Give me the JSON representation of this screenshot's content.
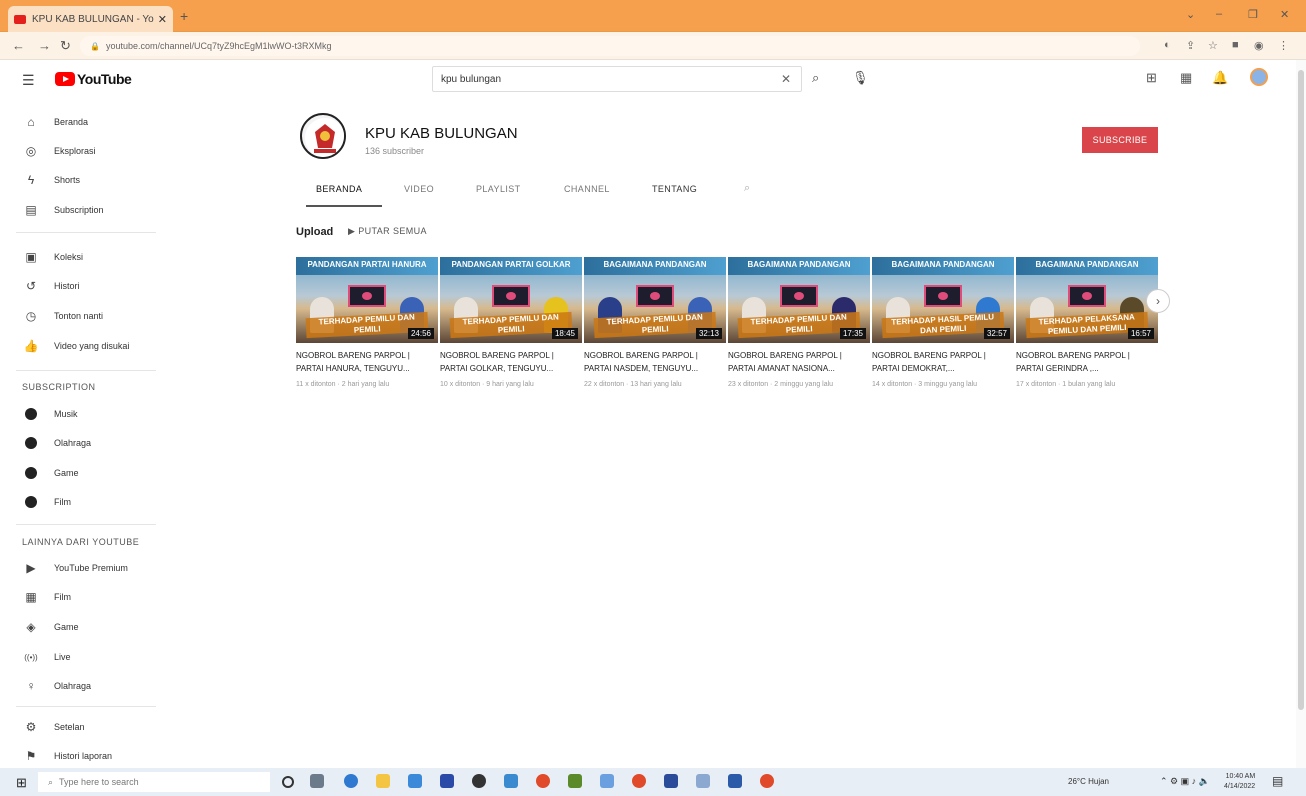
{
  "browser": {
    "tab_title": "KPU KAB BULUNGAN - YouTube",
    "tab_close": "✕",
    "new_tab": "+",
    "url": "youtube.com/channel/UCq7tyZ9hcEgM1lwWO-t3RXMkg",
    "window_controls": [
      "⌄",
      "–",
      "❐",
      "✕"
    ]
  },
  "youtube": {
    "logo_text": "YouTube",
    "search_value": "kpu bulungan",
    "search_clear": "✕"
  },
  "sidebar": {
    "main": [
      {
        "icon": "⌂",
        "label": "Beranda"
      },
      {
        "icon": "◎",
        "label": "Eksplorasi"
      },
      {
        "icon": "ϟ",
        "label": "Shorts"
      },
      {
        "icon": "▤",
        "label": "Subscription"
      }
    ],
    "library": [
      {
        "icon": "▣",
        "label": "Koleksi"
      },
      {
        "icon": "↺",
        "label": "Histori"
      },
      {
        "icon": "◷",
        "label": "Tonton nanti"
      },
      {
        "icon": "👍",
        "label": "Video yang disukai"
      }
    ],
    "subscription_header": "SUBSCRIPTION",
    "subscriptions": [
      {
        "label": "Musik"
      },
      {
        "label": "Olahraga"
      },
      {
        "label": "Game"
      },
      {
        "label": "Film"
      }
    ],
    "more_header": "LAINNYA DARI YOUTUBE",
    "more": [
      {
        "icon": "▶",
        "label": "YouTube Premium"
      },
      {
        "icon": "▦",
        "label": "Film"
      },
      {
        "icon": "◈",
        "label": "Game"
      },
      {
        "icon": "((•))",
        "label": "Live"
      },
      {
        "icon": "♀",
        "label": "Olahraga"
      }
    ],
    "settings": [
      {
        "icon": "⚙",
        "label": "Setelan"
      },
      {
        "icon": "⚑",
        "label": "Histori laporan"
      }
    ]
  },
  "channel": {
    "name": "KPU KAB BULUNGAN",
    "subscribers": "136 subscriber",
    "subscribe_label": "SUBSCRIBE",
    "tabs": [
      "BERANDA",
      "VIDEO",
      "PLAYLIST",
      "CHANNEL",
      "TENTANG"
    ],
    "section_title": "Upload",
    "play_all": "▶  PUTAR SEMUA"
  },
  "videos": [
    {
      "thumb_title": "PANDANGAN PARTAI HANURA",
      "overlay": "TERHADAP PEMILU DAN PEMILI",
      "duration": "24:56",
      "title": "NGOBROL BARENG PARPOL | PARTAI HANURA, TENGUYU...",
      "meta": "11 x ditonton · 2 hari yang lalu"
    },
    {
      "thumb_title": "PANDANGAN PARTAI GOLKAR",
      "overlay": "TERHADAP PEMILU DAN PEMILI",
      "duration": "18:45",
      "title": "NGOBROL BARENG PARPOL | PARTAI GOLKAR, TENGUYU...",
      "meta": "10 x ditonton · 9 hari yang lalu"
    },
    {
      "thumb_title": "BAGAIMANA PANDANGAN",
      "overlay": "TERHADAP PEMILU DAN PEMILI",
      "duration": "32:13",
      "title": "NGOBROL BARENG PARPOL | PARTAI NASDEM, TENGUYU...",
      "meta": "22 x ditonton · 13 hari yang lalu"
    },
    {
      "thumb_title": "BAGAIMANA PANDANGAN",
      "overlay": "TERHADAP PEMILU DAN PEMILI",
      "duration": "17:35",
      "title": "NGOBROL BARENG PARPOL | PARTAI AMANAT NASIONA...",
      "meta": "23 x ditonton · 2 minggu yang lalu"
    },
    {
      "thumb_title": "BAGAIMANA PANDANGAN",
      "overlay": "TERHADAP HASIL PEMILU DAN PEMILI",
      "duration": "32:57",
      "title": "NGOBROL BARENG PARPOL | PARTAI DEMOKRAT,...",
      "meta": "14 x ditonton · 3 minggu yang lalu"
    },
    {
      "thumb_title": "BAGAIMANA PANDANGAN",
      "overlay": "TERHADAP PELAKSANA PEMILU DAN PEMILI",
      "duration": "16:57",
      "title": "NGOBROL BARENG PARPOL | PARTAI GERINDRA ,...",
      "meta": "17 x ditonton · 1 bulan yang lalu"
    }
  ],
  "taskbar": {
    "search_placeholder": "Type here to search",
    "weather": "26°C Hujan",
    "time": "10:40 AM",
    "date": "4/14/2022"
  },
  "colors": {
    "titlebar": "#f6a04e",
    "subscribe": "#d9454a",
    "youtube_red": "#ff0000"
  }
}
